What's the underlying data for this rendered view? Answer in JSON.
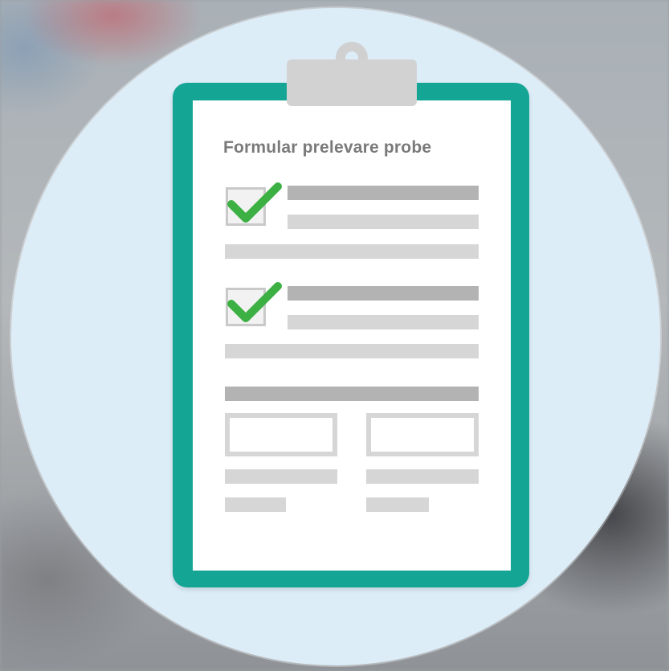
{
  "form": {
    "title": "Formular prelevare probe",
    "checklist": [
      {
        "checked": true,
        "check_icon": "check-icon"
      },
      {
        "checked": true,
        "check_icon": "check-icon"
      }
    ]
  },
  "colors": {
    "circle": "#dcedf8",
    "board": "#14a595",
    "check": "#3cb043",
    "bar_dark": "#b3b3b3",
    "bar_light": "#d6d6d6"
  }
}
